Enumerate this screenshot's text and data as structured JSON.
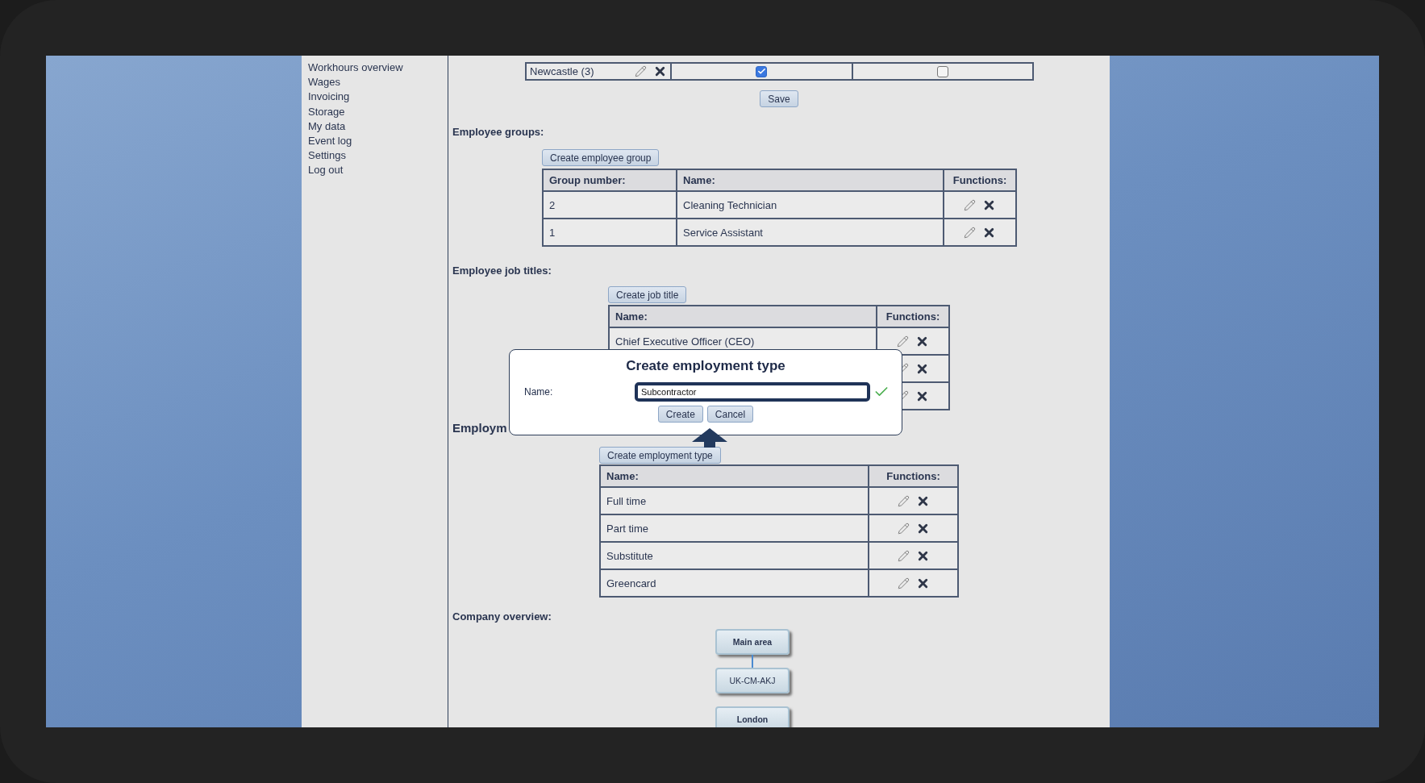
{
  "sidebar": {
    "items": [
      "Workhours overview",
      "Wages",
      "Invoicing",
      "Storage",
      "My data",
      "Event log",
      "Settings",
      "Log out"
    ]
  },
  "locations_table": {
    "rows": [
      {
        "name": "Newcastle (3)",
        "checks": [
          true,
          false
        ]
      }
    ]
  },
  "save_button": "Save",
  "employee_groups": {
    "heading": "Employee groups:",
    "create_button": "Create employee group",
    "columns": [
      "Group number:",
      "Name:",
      "Functions:"
    ],
    "rows": [
      {
        "number": "2",
        "name": "Cleaning Technician"
      },
      {
        "number": "1",
        "name": "Service Assistant"
      }
    ]
  },
  "job_titles": {
    "heading": "Employee job titles:",
    "create_button": "Create job title",
    "columns": [
      "Name:",
      "Functions:"
    ],
    "rows": [
      {
        "kind": "text",
        "name": "Chief Executive Officer (CEO)"
      },
      {
        "kind": "covered"
      },
      {
        "kind": "covered"
      }
    ]
  },
  "employment_types": {
    "heading": "Employm",
    "create_button": "Create employment type",
    "columns": [
      "Name:",
      "Functions:"
    ],
    "rows": [
      {
        "name": "Full time"
      },
      {
        "name": "Part time"
      },
      {
        "name": "Substitute"
      },
      {
        "name": "Greencard"
      }
    ]
  },
  "company_overview": {
    "heading": "Company overview:",
    "nodes": [
      {
        "label": "Main area",
        "bold": true
      },
      {
        "label": "UK-CM-AKJ",
        "bold": false,
        "linked": true
      },
      {
        "label": "London",
        "bold": true,
        "linked": false
      }
    ]
  },
  "dialog": {
    "title": "Create employment type",
    "field_label": "Name:",
    "value": "Subcontractor",
    "valid": true,
    "buttons": [
      "Create",
      "Cancel"
    ]
  }
}
